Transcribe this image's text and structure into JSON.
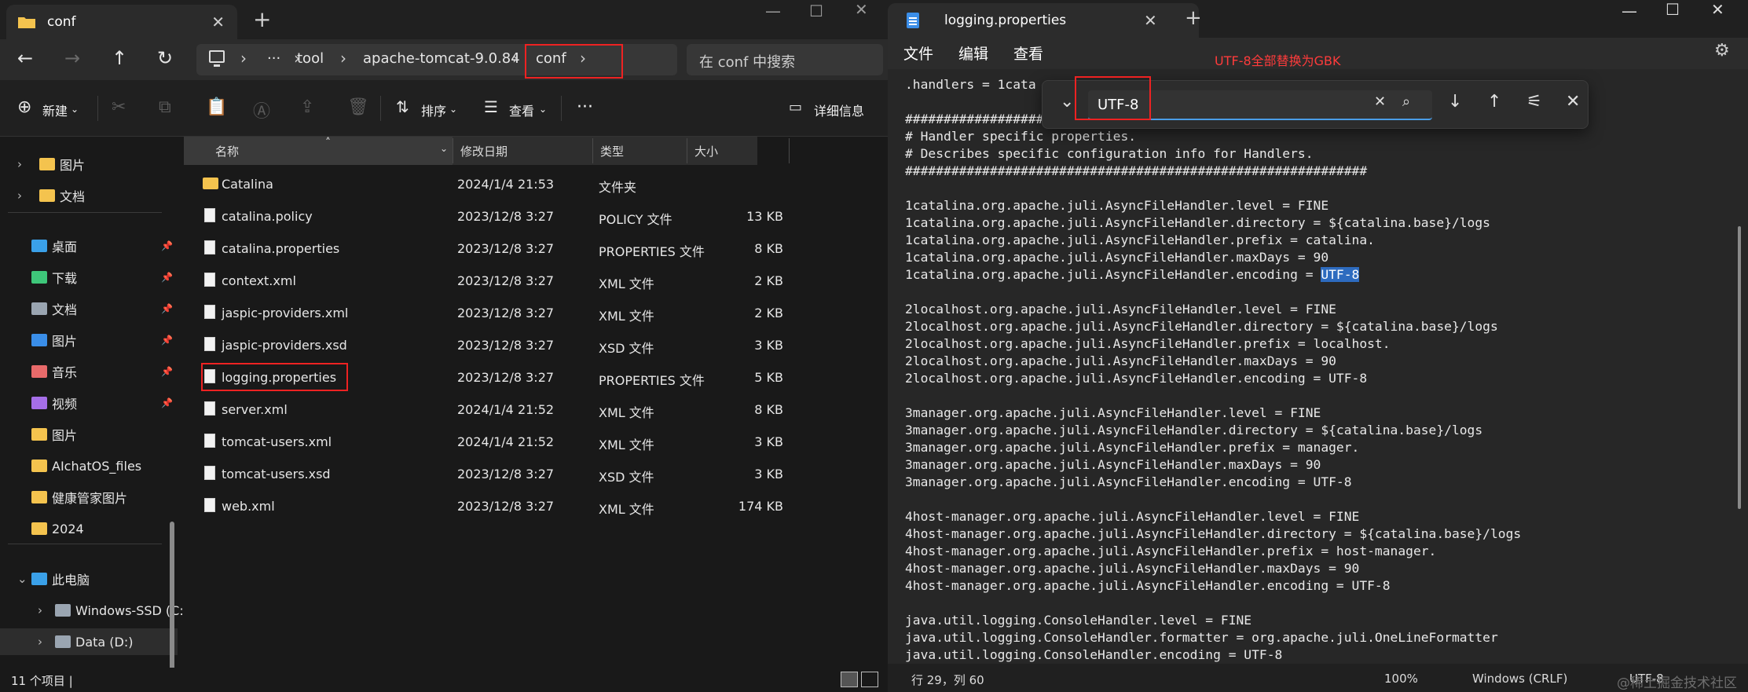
{
  "explorer": {
    "tab_title": "conf",
    "breadcrumb": [
      "tool",
      "apache-tomcat-9.0.84",
      "conf"
    ],
    "breadcrumb_more": "···",
    "search_placeholder": "在 conf 中搜索",
    "toolbar": {
      "new_label": "新建",
      "sort_label": "排序",
      "view_label": "查看",
      "more_label": "···",
      "details_label": "详细信息"
    },
    "sidebar": [
      {
        "label": "图片",
        "icon": "folder-icon",
        "chevron": true
      },
      {
        "label": "文档",
        "icon": "folder-icon",
        "chevron": true
      },
      {
        "label": "桌面",
        "icon": "desktop-icon",
        "pinned": true
      },
      {
        "label": "下载",
        "icon": "download-icon",
        "pinned": true
      },
      {
        "label": "文档",
        "icon": "documents-icon",
        "pinned": true
      },
      {
        "label": "图片",
        "icon": "pictures-icon",
        "pinned": true
      },
      {
        "label": "音乐",
        "icon": "music-icon",
        "pinned": true
      },
      {
        "label": "视频",
        "icon": "video-icon",
        "pinned": true
      },
      {
        "label": "图片",
        "icon": "folder-icon"
      },
      {
        "label": "AIchatOS_files",
        "icon": "folder-icon"
      },
      {
        "label": "健康管家图片",
        "icon": "folder-icon"
      },
      {
        "label": "2024",
        "icon": "folder-icon"
      },
      {
        "label": "此电脑",
        "icon": "pc-icon",
        "expanded": true
      },
      {
        "label": "Windows-SSD (C:)",
        "icon": "drive-icon",
        "chevron": true
      },
      {
        "label": "Data (D:)",
        "icon": "drive-icon",
        "chevron": true
      }
    ],
    "columns": [
      "名称",
      "修改日期",
      "类型",
      "大小"
    ],
    "files": [
      {
        "name": "Catalina",
        "date": "2024/1/4 21:53",
        "type": "文件夹",
        "size": "",
        "kind": "folder"
      },
      {
        "name": "catalina.policy",
        "date": "2023/12/8 3:27",
        "type": "POLICY 文件",
        "size": "13 KB",
        "kind": "file"
      },
      {
        "name": "catalina.properties",
        "date": "2023/12/8 3:27",
        "type": "PROPERTIES 文件",
        "size": "8 KB",
        "kind": "file"
      },
      {
        "name": "context.xml",
        "date": "2023/12/8 3:27",
        "type": "XML 文件",
        "size": "2 KB",
        "kind": "file"
      },
      {
        "name": "jaspic-providers.xml",
        "date": "2023/12/8 3:27",
        "type": "XML 文件",
        "size": "2 KB",
        "kind": "file"
      },
      {
        "name": "jaspic-providers.xsd",
        "date": "2023/12/8 3:27",
        "type": "XSD 文件",
        "size": "3 KB",
        "kind": "file"
      },
      {
        "name": "logging.properties",
        "date": "2023/12/8 3:27",
        "type": "PROPERTIES 文件",
        "size": "5 KB",
        "kind": "file",
        "highlighted": true
      },
      {
        "name": "server.xml",
        "date": "2024/1/4 21:52",
        "type": "XML 文件",
        "size": "8 KB",
        "kind": "file"
      },
      {
        "name": "tomcat-users.xml",
        "date": "2024/1/4 21:52",
        "type": "XML 文件",
        "size": "3 KB",
        "kind": "file"
      },
      {
        "name": "tomcat-users.xsd",
        "date": "2023/12/8 3:27",
        "type": "XSD 文件",
        "size": "3 KB",
        "kind": "file"
      },
      {
        "name": "web.xml",
        "date": "2023/12/8 3:27",
        "type": "XML 文件",
        "size": "174 KB",
        "kind": "file"
      }
    ],
    "status": "11 个项目  |"
  },
  "notepad": {
    "tab_title": "logging.properties",
    "menu": [
      "文件",
      "编辑",
      "查看"
    ],
    "find": {
      "query": "UTF-8",
      "annotation": "UTF-8全部替换为GBK"
    },
    "lines": [
      ".handlers = 1cata",
      "",
      "############################################################",
      "# Handler specific properties.",
      "# Describes specific configuration info for Handlers.",
      "############################################################",
      "",
      "1catalina.org.apache.juli.AsyncFileHandler.level = FINE",
      "1catalina.org.apache.juli.AsyncFileHandler.directory = ${catalina.base}/logs",
      "1catalina.org.apache.juli.AsyncFileHandler.prefix = catalina.",
      "1catalina.org.apache.juli.AsyncFileHandler.maxDays = 90",
      "1catalina.org.apache.juli.AsyncFileHandler.encoding = ",
      "",
      "2localhost.org.apache.juli.AsyncFileHandler.level = FINE",
      "2localhost.org.apache.juli.AsyncFileHandler.directory = ${catalina.base}/logs",
      "2localhost.org.apache.juli.AsyncFileHandler.prefix = localhost.",
      "2localhost.org.apache.juli.AsyncFileHandler.maxDays = 90",
      "2localhost.org.apache.juli.AsyncFileHandler.encoding = UTF-8",
      "",
      "3manager.org.apache.juli.AsyncFileHandler.level = FINE",
      "3manager.org.apache.juli.AsyncFileHandler.directory = ${catalina.base}/logs",
      "3manager.org.apache.juli.AsyncFileHandler.prefix = manager.",
      "3manager.org.apache.juli.AsyncFileHandler.maxDays = 90",
      "3manager.org.apache.juli.AsyncFileHandler.encoding = UTF-8",
      "",
      "4host-manager.org.apache.juli.AsyncFileHandler.level = FINE",
      "4host-manager.org.apache.juli.AsyncFileHandler.directory = ${catalina.base}/logs",
      "4host-manager.org.apache.juli.AsyncFileHandler.prefix = host-manager.",
      "4host-manager.org.apache.juli.AsyncFileHandler.maxDays = 90",
      "4host-manager.org.apache.juli.AsyncFileHandler.encoding = UTF-8",
      "",
      "java.util.logging.ConsoleHandler.level = FINE",
      "java.util.logging.ConsoleHandler.formatter = org.apache.juli.OneLineFormatter",
      "java.util.logging.ConsoleHandler.encoding = UTF-8"
    ],
    "highlight_text": "UTF-8",
    "status": {
      "position": "行 29，列 60",
      "zoom": "100%",
      "line_ending": "Windows (CRLF)",
      "encoding": "UTF-8"
    },
    "watermark": "@稀土掘金技术社区"
  }
}
